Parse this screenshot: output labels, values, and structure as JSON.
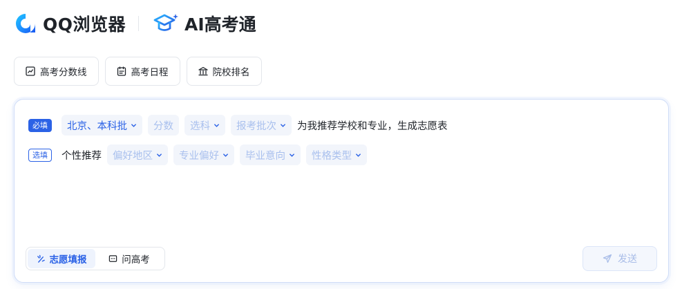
{
  "header": {
    "brand_name": "QQ浏览器",
    "product_name": "AI高考通"
  },
  "quick_links": [
    {
      "label": "高考分数线",
      "icon": "line-chart-icon"
    },
    {
      "label": "高考日程",
      "icon": "calendar-icon"
    },
    {
      "label": "院校排名",
      "icon": "institution-icon"
    }
  ],
  "form": {
    "required_tag": "必填",
    "optional_tag": "选填",
    "required_row": {
      "region_batch": "北京、本科批",
      "score_placeholder": "分数",
      "subject_placeholder": "选科",
      "batch_placeholder": "报考批次",
      "suffix": "为我推荐学校和专业，生成志愿表"
    },
    "optional_row": {
      "prefix": "个性推荐",
      "region_pref": "偏好地区",
      "major_pref": "专业偏好",
      "career_pref": "毕业意向",
      "personality": "性格类型"
    }
  },
  "modes": [
    {
      "label": "志愿填报",
      "active": true
    },
    {
      "label": "问高考",
      "active": false
    }
  ],
  "send_label": "发送",
  "colors": {
    "accent": "#2b62e6",
    "placeholder": "#a9c0ee",
    "chip_bg": "#f2f5fb"
  }
}
